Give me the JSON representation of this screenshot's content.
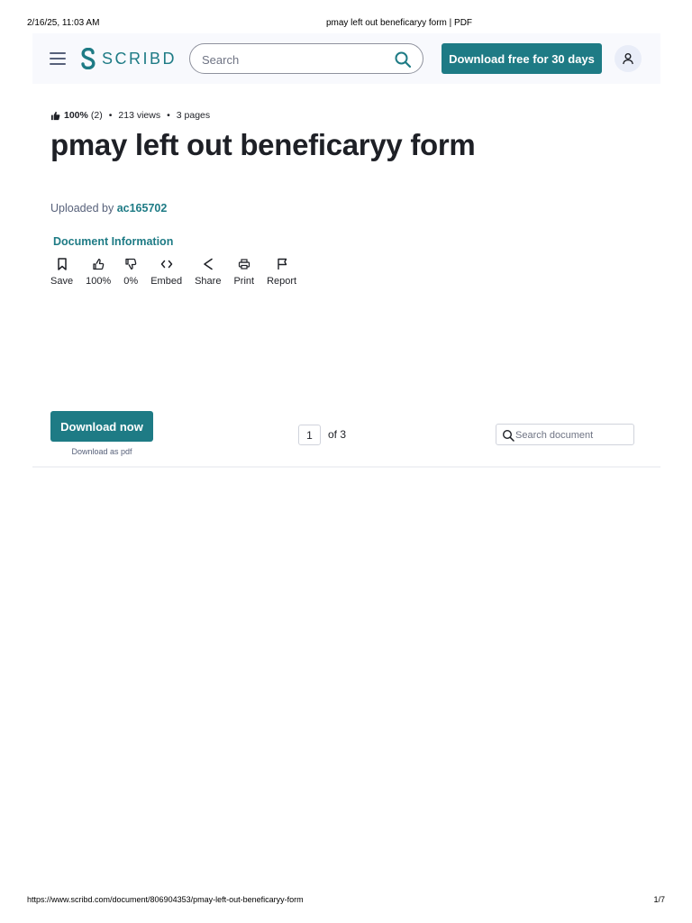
{
  "print": {
    "date": "2/16/25, 11:03 AM",
    "title": "pmay left out beneficaryy form | PDF",
    "url": "https://www.scribd.com/document/806904353/pmay-left-out-beneficaryy-form",
    "page": "1/7"
  },
  "header": {
    "logo_text": "SCRIBD",
    "search_placeholder": "Search",
    "cta_label": "Download free for 30 days",
    "icons": [
      "menu-icon",
      "scribd-logo-icon",
      "search-icon",
      "user-icon"
    ]
  },
  "doc": {
    "rating": "100%",
    "rating_count": "(2)",
    "views": "213 views",
    "pages": "3 pages",
    "title": "pmay left out beneficaryy form",
    "uploaded_prefix": "Uploaded by",
    "uploader": "ac165702",
    "info_link": "Document Information"
  },
  "actions": [
    {
      "label": "Save",
      "icon": "bookmark-icon"
    },
    {
      "label": "100%",
      "icon": "thumbs-up-icon"
    },
    {
      "label": "0%",
      "icon": "thumbs-down-icon"
    },
    {
      "label": "Embed",
      "icon": "code-icon"
    },
    {
      "label": "Share",
      "icon": "share-icon"
    },
    {
      "label": "Print",
      "icon": "printer-icon"
    },
    {
      "label": "Report",
      "icon": "flag-icon"
    }
  ],
  "toolbar": {
    "download_label": "Download now",
    "download_sub": "Download as pdf",
    "page_value": "1",
    "page_of": "of 3",
    "search_placeholder": "Search document"
  },
  "colors": {
    "accent": "#1e7b85",
    "header_bg": "#f8f9fd",
    "text": "#1e2026",
    "muted": "#57617a"
  }
}
